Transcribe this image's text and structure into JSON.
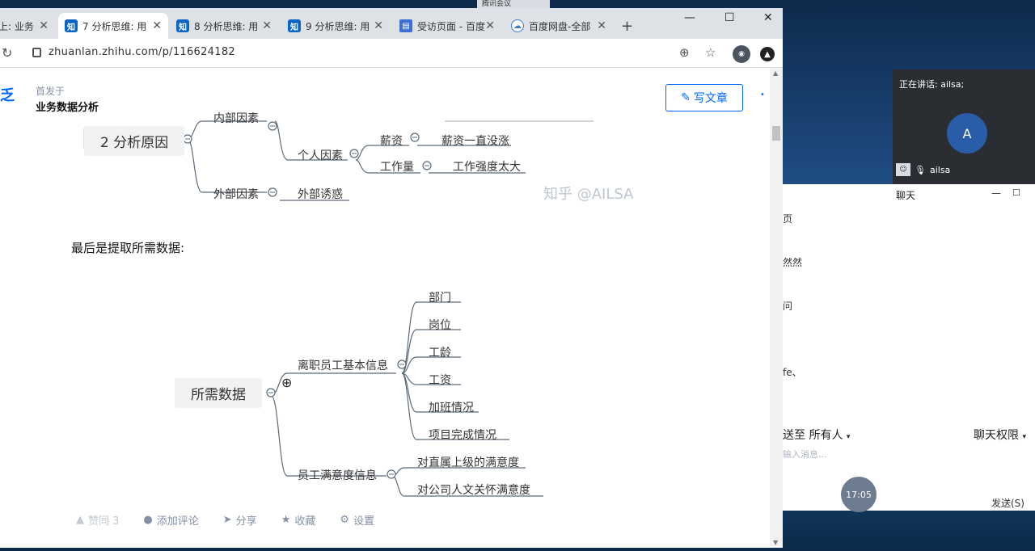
{
  "system": {
    "meeting_app_label": "腾讯会议"
  },
  "tabs": [
    {
      "label": "上: 业务",
      "favicon": "知",
      "active": false
    },
    {
      "label": "7 分析思维: 用",
      "favicon": "知",
      "active": true
    },
    {
      "label": "8 分析思维: 用",
      "favicon": "知",
      "active": false
    },
    {
      "label": "9 分析思维: 用",
      "favicon": "知",
      "active": false
    },
    {
      "label": "受访页面 - 百度",
      "favicon": "doc",
      "active": false
    },
    {
      "label": "百度网盘-全部",
      "favicon": "cloud",
      "active": false
    }
  ],
  "address": {
    "url": "zhuanlan.zhihu.com/p/116624182"
  },
  "article": {
    "logo": "乏",
    "published_in": "首发于",
    "column": "业务数据分析",
    "write_button": "写文章",
    "watermark": "知乎 @AILSA",
    "paragraph": "最后是提取所需数据:"
  },
  "mindmap1": {
    "root": "2 分析原因",
    "internal": "内部因素",
    "personal": "个人因素",
    "salary": "薪资",
    "salary_detail": "薪资一直没涨",
    "workload": "工作量",
    "workload_detail": "工作强度太大",
    "external": "外部因素",
    "external_detail": "外部诱惑"
  },
  "mindmap2": {
    "root": "所需数据",
    "basic_info": "离职员工基本信息",
    "items": [
      "部门",
      "岗位",
      "工龄",
      "工资",
      "加班情况",
      "项目完成情况"
    ],
    "satisfaction": "员工满意度信息",
    "sat_items": [
      "对直属上级的满意度",
      "对公司人文关怀满意度"
    ]
  },
  "actions": {
    "vote": "赞同 3",
    "comment": "添加评论",
    "share": "分享",
    "favorite": "收藏",
    "settings": "设置"
  },
  "meeting": {
    "speaking": "正在讲话: ailsa;",
    "avatar_letter": "A",
    "user_name": "ailsa"
  },
  "chat": {
    "title": "聊天",
    "lines": [
      "页",
      "然然",
      "问",
      "fe、"
    ],
    "send_to": "送至 所有人",
    "permission": "聊天权限",
    "hint": "输入消息...",
    "time": "17:05",
    "send": "发送(S)"
  }
}
